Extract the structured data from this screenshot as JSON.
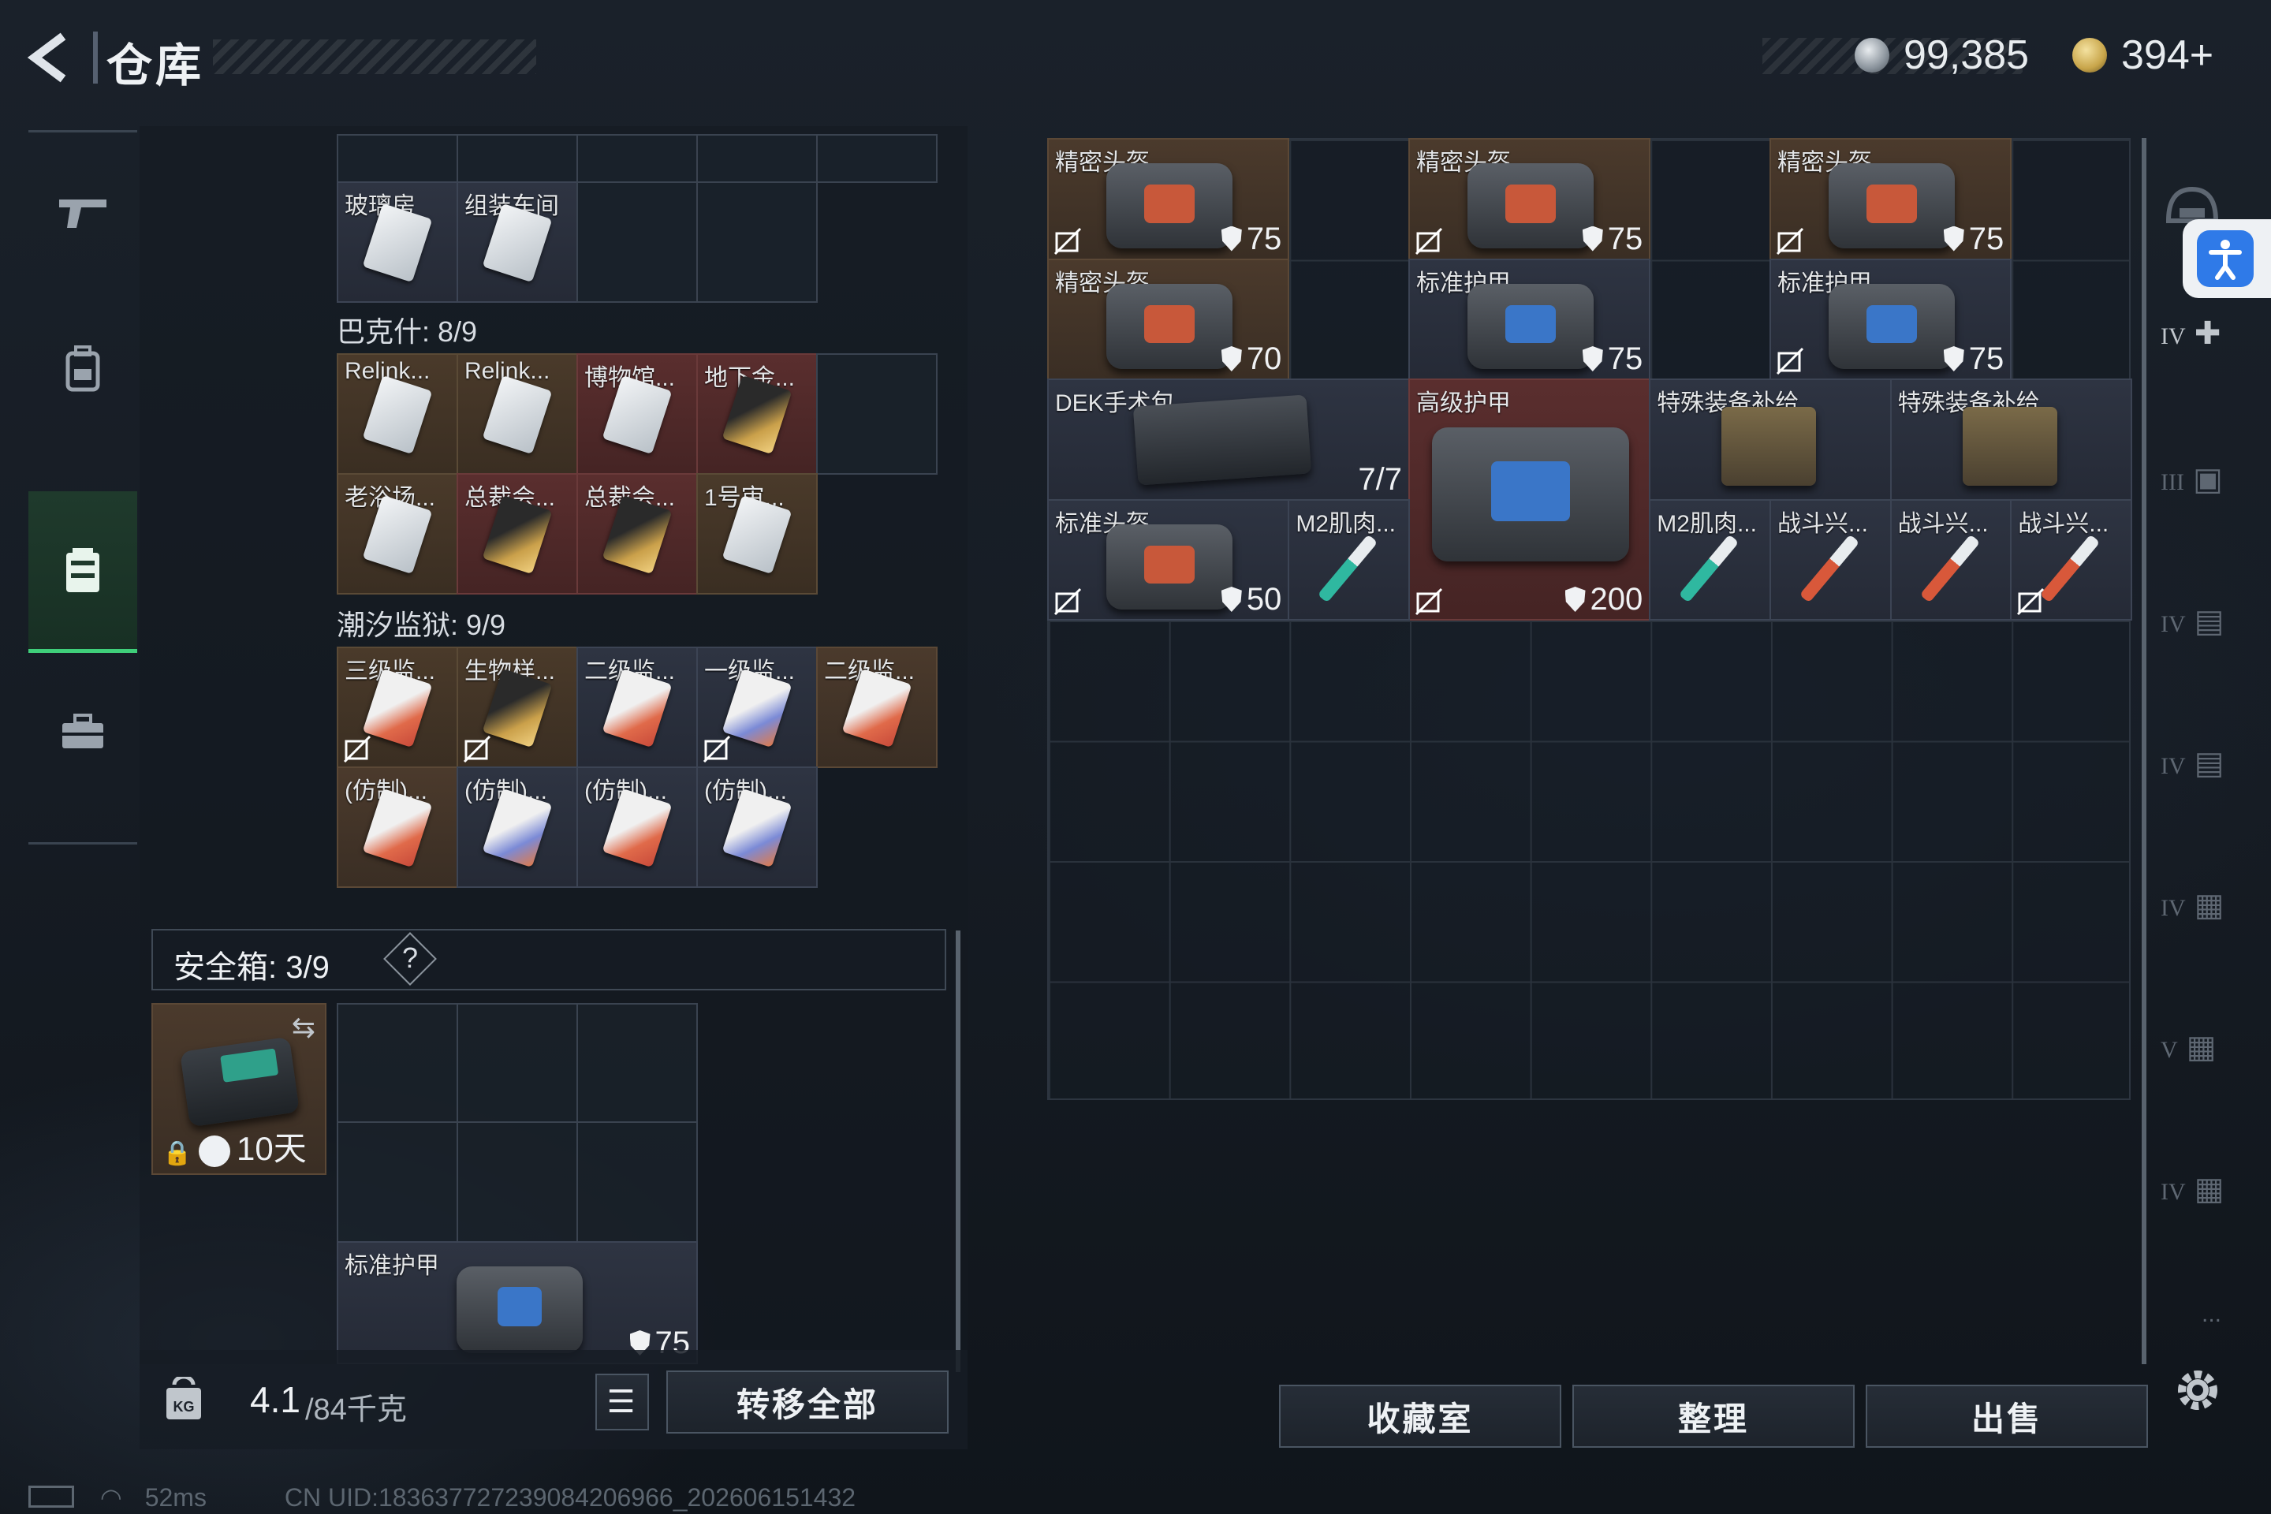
{
  "header": {
    "title": "仓库",
    "currency1": "99,385",
    "currency2": "394+",
    "currency1_color": "#c9ced4",
    "currency2_color": "#c8a54a"
  },
  "nav": {
    "items": [
      "gun-icon",
      "backpack-icon",
      "container-icon",
      "toolbox-icon"
    ],
    "active": 2
  },
  "left": {
    "top_row_labels": [
      "玻璃房",
      "组装车间"
    ],
    "baksh_label": "巴克什: 8/9",
    "baksh_items": [
      "Relink...",
      "Relink...",
      "博物馆...",
      "地下金...",
      "老浴场...",
      "总裁会...",
      "总裁会...",
      "1号审..."
    ],
    "tide_label": "潮汐监狱: 9/9",
    "tide_items": [
      "三级监...",
      "生物样...",
      "二级监...",
      "一级监...",
      "二级监...",
      "(仿制)...",
      "(仿制)...",
      "(仿制)...",
      "(仿制)..."
    ],
    "safebox_label": "安全箱: 3/9",
    "safebox_help": "?",
    "safebox_timer": "10天",
    "safebox_item_label": "标准护甲",
    "safebox_item_value": "75",
    "weight": "4.1",
    "weight_max": "/84千克",
    "transfer_all": "转移全部"
  },
  "right": {
    "items": [
      {
        "label": "精密头盔",
        "value": "75",
        "kind": "helmet"
      },
      {
        "label": "精密头盔",
        "value": "75",
        "kind": "helmet"
      },
      {
        "label": "精密头盔",
        "value": "75",
        "kind": "helmet"
      },
      {
        "label": "精密头盔",
        "value": "70",
        "kind": "helmet"
      },
      {
        "label": "标准护甲",
        "value": "75",
        "kind": "armor"
      },
      {
        "label": "标准护甲",
        "value": "75",
        "kind": "armor"
      },
      {
        "label": "DEK手术包",
        "value": "7/7",
        "kind": "medkit"
      },
      {
        "label": "高级护甲",
        "value": "200",
        "kind": "armor-big"
      },
      {
        "label": "特殊装备补给",
        "value": "",
        "kind": "crate"
      },
      {
        "label": "特殊装备补给",
        "value": "",
        "kind": "crate"
      },
      {
        "label": "标准头盔",
        "value": "50",
        "kind": "helmet"
      },
      {
        "label": "M2肌肉...",
        "value": "",
        "kind": "syringe-green"
      },
      {
        "label": "M2肌肉...",
        "value": "",
        "kind": "syringe-green"
      },
      {
        "label": "战斗兴...",
        "value": "",
        "kind": "syringe-red"
      },
      {
        "label": "战斗兴...",
        "value": "",
        "kind": "syringe-red"
      },
      {
        "label": "战斗兴...",
        "value": "",
        "kind": "syringe-red"
      }
    ],
    "btn_collection": "收藏室",
    "btn_sort": "整理",
    "btn_sell": "出售"
  },
  "side": {
    "icons": [
      "helmet-slot-icon",
      "medkit-slot-icon",
      "armor-slot-icon",
      "rig-slot-icon",
      "rig-slot-icon",
      "bag-slot-icon",
      "bag-slot-icon",
      "bag-slot-icon"
    ],
    "labels": [
      "IV",
      "III",
      "IV",
      "IV",
      "IV",
      "V",
      "IV"
    ],
    "more": "..."
  },
  "status": {
    "ping": "52ms",
    "uid": "CN UID:18363772723908420696​6_202606151432"
  }
}
